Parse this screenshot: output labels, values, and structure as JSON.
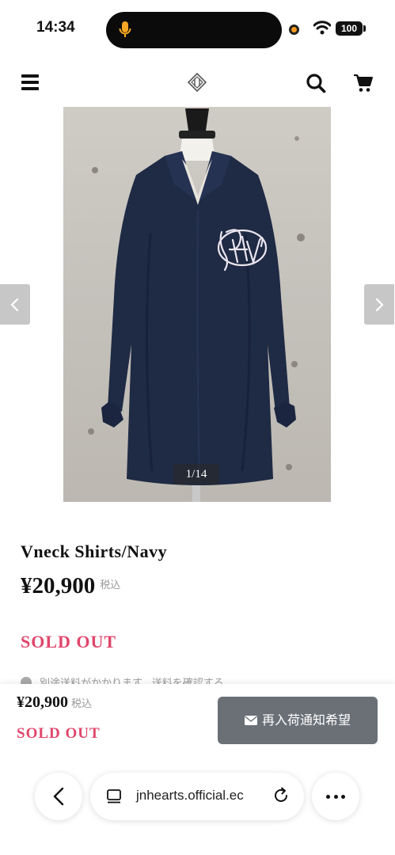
{
  "status_bar": {
    "time": "14:34",
    "battery": "100"
  },
  "header": {
    "menu_icon": "hamburger-icon",
    "logo_icon": "brand-logo-icon",
    "search_icon": "search-icon",
    "cart_icon": "cart-icon"
  },
  "gallery": {
    "counter": "1/14",
    "prev_icon": "chevron-left-icon",
    "next_icon": "chevron-right-icon"
  },
  "product": {
    "title": "Vneck Shirts/Navy",
    "price": "¥20,900",
    "tax_label": "税込",
    "status": "SOLD OUT",
    "shipping_note": "別途送料がかかります。送料を確認する"
  },
  "sticky_bar": {
    "price": "¥20,900",
    "tax_label": "税込",
    "status": "SOLD OUT",
    "restock_button": "再入荷通知希望"
  },
  "browser": {
    "url": "jnhearts.official.ec"
  },
  "colors": {
    "sold_out": "#e0466b",
    "button_bg": "#6b7077",
    "shirt": "#1f2a44"
  }
}
